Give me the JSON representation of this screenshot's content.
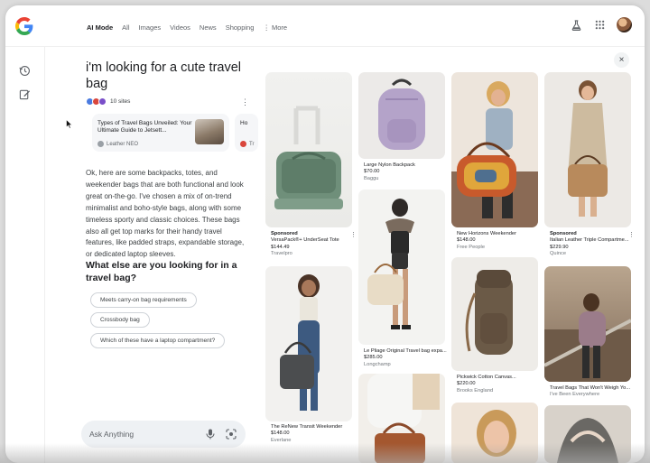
{
  "tabs": [
    "AI Mode",
    "All",
    "Images",
    "Videos",
    "News",
    "Shopping",
    "⋮ More"
  ],
  "query": "i'm looking for a cute travel bag",
  "sites_label": "10 sites",
  "source_cards": [
    {
      "title": "Types of Travel Bags Unveiled: Your Ultimate Guide to Jetsett...",
      "source": "Leather NEO"
    },
    {
      "title": "Ho",
      "source": "Tr"
    }
  ],
  "answer": "Ok, here are some backpacks, totes, and weekender bags that are both functional and look great on-the-go. I've chosen a mix of on-trend minimalist and boho-style bags, along with some timeless sporty and classic choices. These bags also all get top marks for their handy travel features, like padded straps, expandable storage, or dedicated laptop sleeves.",
  "followup_question": "What else are you looking for in a travel bag?",
  "chips": [
    "Meets carry-on bag requirements",
    "Crossbody bag",
    "Which of these have a laptop compartment?"
  ],
  "ask_placeholder": "Ask Anything",
  "close_label": "×",
  "products": [
    {
      "sponsored": "Sponsored",
      "name": "VersaPack®+ UnderSeat Tote",
      "price": "$144.49",
      "store": "Travelpro"
    },
    {
      "sponsored": "",
      "name": "The ReNew Transit Weekender",
      "price": "$148.00",
      "store": "Everlane"
    },
    {
      "sponsored": "",
      "name": "Large Nylon Backpack",
      "price": "$70.00",
      "store": "Baggu"
    },
    {
      "sponsored": "",
      "name": "Le Pliage Original Travel bag expa...",
      "price": "$285.00",
      "store": "Longchamp"
    },
    {
      "sponsored": "",
      "name": "New Horizons Weekender",
      "price": "$148.00",
      "store": "Free People"
    },
    {
      "sponsored": "",
      "name": "Pickwick Cotton Canvas...",
      "price": "$220.00",
      "store": "Brooks England"
    },
    {
      "sponsored": "Sponsored",
      "name": "Italian Leather Triple Compartme...",
      "price": "$229.90",
      "store": "Quince"
    },
    {
      "sponsored": "",
      "name": "Travel Bags That Won't Weigh Yo...",
      "price": "",
      "store": "I've Been Everywhere"
    }
  ],
  "icons": {
    "logo": "google-logo",
    "labs": "flask-icon",
    "apps": "apps-grid-icon",
    "history": "history-icon",
    "new_chat": "edit-icon",
    "mic": "microphone-icon",
    "lens": "lens-icon"
  }
}
